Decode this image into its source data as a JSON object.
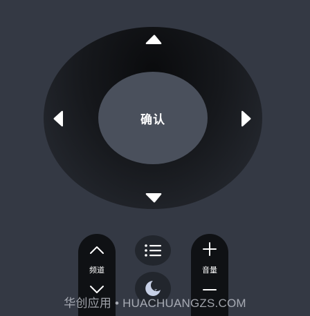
{
  "remote": {
    "ok_label": "确认",
    "channel_label": "频道",
    "volume_label": "音量"
  },
  "icons": {
    "up": "triangle-up-icon",
    "down": "triangle-down-icon",
    "left": "triangle-left-icon",
    "right": "triangle-right-icon",
    "channel_up": "chevron-up-icon",
    "channel_down": "chevron-down-icon",
    "menu": "list-icon",
    "sleep": "moon-icon",
    "volume_up": "plus-icon",
    "volume_down": "minus-icon"
  },
  "watermark": "华创应用 • HUACHUANGZS.COM",
  "colors": {
    "background": "#343944",
    "dpad": "#16181c",
    "ok_button": "#4a505c",
    "pill": "#0f1114",
    "icon": "#ffffff",
    "sleep_icon": "#c7d0e6"
  }
}
